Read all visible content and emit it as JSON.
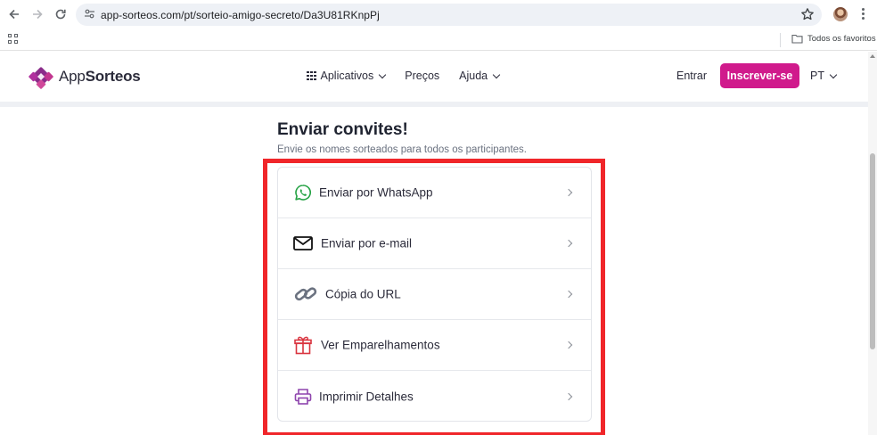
{
  "browser": {
    "url": "app-sorteos.com/pt/sorteio-amigo-secreto/Da3U81RKnpPj",
    "bookmarks_all": "Todos os favoritos"
  },
  "header": {
    "logo_prefix": "App",
    "logo_bold": "Sorteos",
    "menu": [
      {
        "label": "Aplicativos",
        "icon": "apps-grid-icon",
        "has_caret": true
      },
      {
        "label": "Preços",
        "has_caret": false
      },
      {
        "label": "Ajuda",
        "has_caret": true
      }
    ],
    "login": "Entrar",
    "signup": "Inscrever-se",
    "language": "PT",
    "brand_color": "#d01a8c"
  },
  "invites": {
    "title": "Enviar convites!",
    "subtitle": "Envie os nomes sorteados para todos os participantes.",
    "options": [
      {
        "label": "Enviar por WhatsApp",
        "icon": "whatsapp-icon",
        "color": "#25a244"
      },
      {
        "label": "Enviar por e-mail",
        "icon": "mail-icon",
        "color": "#111111"
      },
      {
        "label": "Cópia do URL",
        "icon": "link-icon",
        "color": "#6b7280"
      },
      {
        "label": "Ver Emparelhamentos",
        "icon": "gift-icon",
        "color": "#d9343f"
      },
      {
        "label": "Imprimir Detalhes",
        "icon": "printer-icon",
        "color": "#8e44ad"
      }
    ],
    "highlight_color": "#f0262a"
  }
}
